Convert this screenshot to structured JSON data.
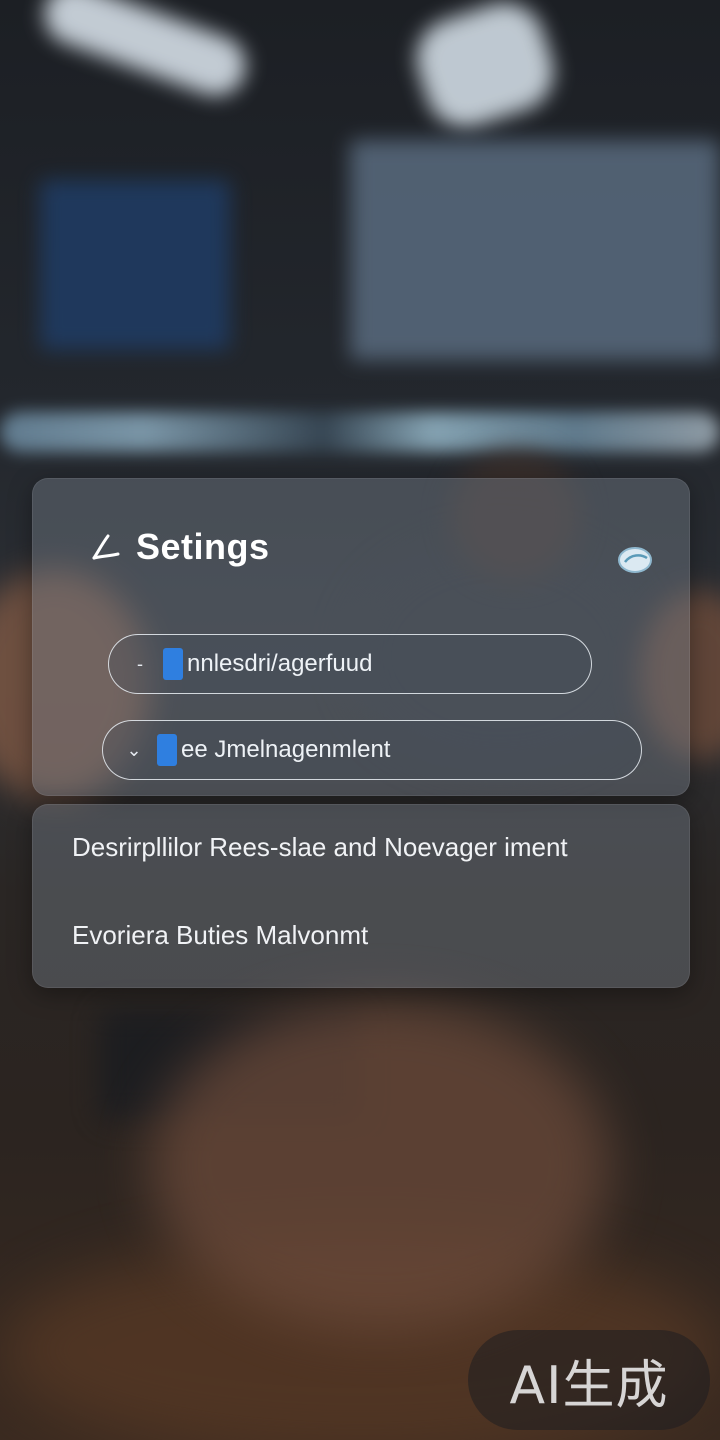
{
  "header": {
    "icon": "leaf-icon",
    "title": "Setings",
    "toggle_icon": "toggle-icon"
  },
  "settings_options": [
    {
      "prefix": "-",
      "label": "nnlesdri/agerfuud"
    },
    {
      "prefix": "⌄",
      "label": "ee Jmelnagenmlent"
    }
  ],
  "info_lines": [
    "Desrirpllilor Rees-slae and Noevager iment",
    "Evoriera Buties Malvonmt"
  ],
  "watermark": "AI生成",
  "colors": {
    "accent": "#2f7fe0",
    "panel": "#78808c",
    "text": "#ffffff"
  }
}
